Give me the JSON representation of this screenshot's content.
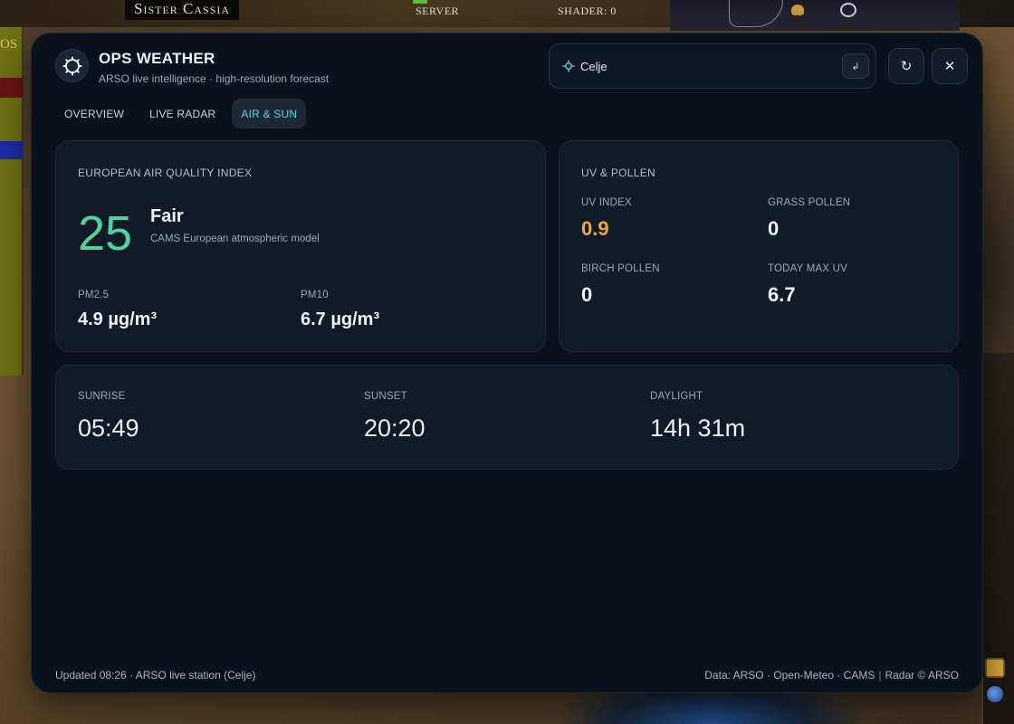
{
  "game": {
    "character_name": "Sister Cassia",
    "server_label": "SERVER",
    "shader_label": "SHADER: 0",
    "left_text": "OS"
  },
  "app": {
    "title": "OPS WEATHER",
    "subtitle": "ARSO live intelligence · high-resolution forecast"
  },
  "search": {
    "value": "Celje",
    "enter_glyph": "↲"
  },
  "controls": {
    "refresh_glyph": "↻",
    "close_glyph": "✕"
  },
  "tabs": [
    {
      "label": "OVERVIEW",
      "active": false
    },
    {
      "label": "LIVE RADAR",
      "active": false
    },
    {
      "label": "AIR & SUN",
      "active": true
    }
  ],
  "air_quality": {
    "title": "EUROPEAN AIR QUALITY INDEX",
    "index": "25",
    "rating": "Fair",
    "model": "CAMS European atmospheric model",
    "pm25_label": "PM2.5",
    "pm25_value": "4.9 µg/m³",
    "pm10_label": "PM10",
    "pm10_value": "6.7 µg/m³",
    "index_color": "#4fd3a0"
  },
  "uv_pollen": {
    "title": "UV & POLLEN",
    "uv_label": "UV INDEX",
    "uv_value": "0.9",
    "grass_label": "GRASS POLLEN",
    "grass_value": "0",
    "birch_label": "BIRCH POLLEN",
    "birch_value": "0",
    "max_uv_label": "TODAY MAX UV",
    "max_uv_value": "6.7",
    "uv_color": "#f0a93c"
  },
  "sun": {
    "sunrise_label": "SUNRISE",
    "sunrise_value": "05:49",
    "sunset_label": "SUNSET",
    "sunset_value": "20:20",
    "daylight_label": "DAYLIGHT",
    "daylight_value": "14h 31m"
  },
  "footer": {
    "updated": "Updated 08:26 · ARSO live station (Celje)",
    "sources": "Data: ARSO · Open-Meteo · CAMS",
    "separator": "|",
    "radar_credit": "Radar © ARSO"
  },
  "colors": {
    "accent": "#5fd0e6",
    "panel_bg": "#0b111b",
    "card_bg": "#111a26"
  },
  "icons": {
    "brand": "sun-gear-icon",
    "search": "location-pin-icon",
    "refresh": "refresh-icon",
    "close": "close-icon"
  }
}
